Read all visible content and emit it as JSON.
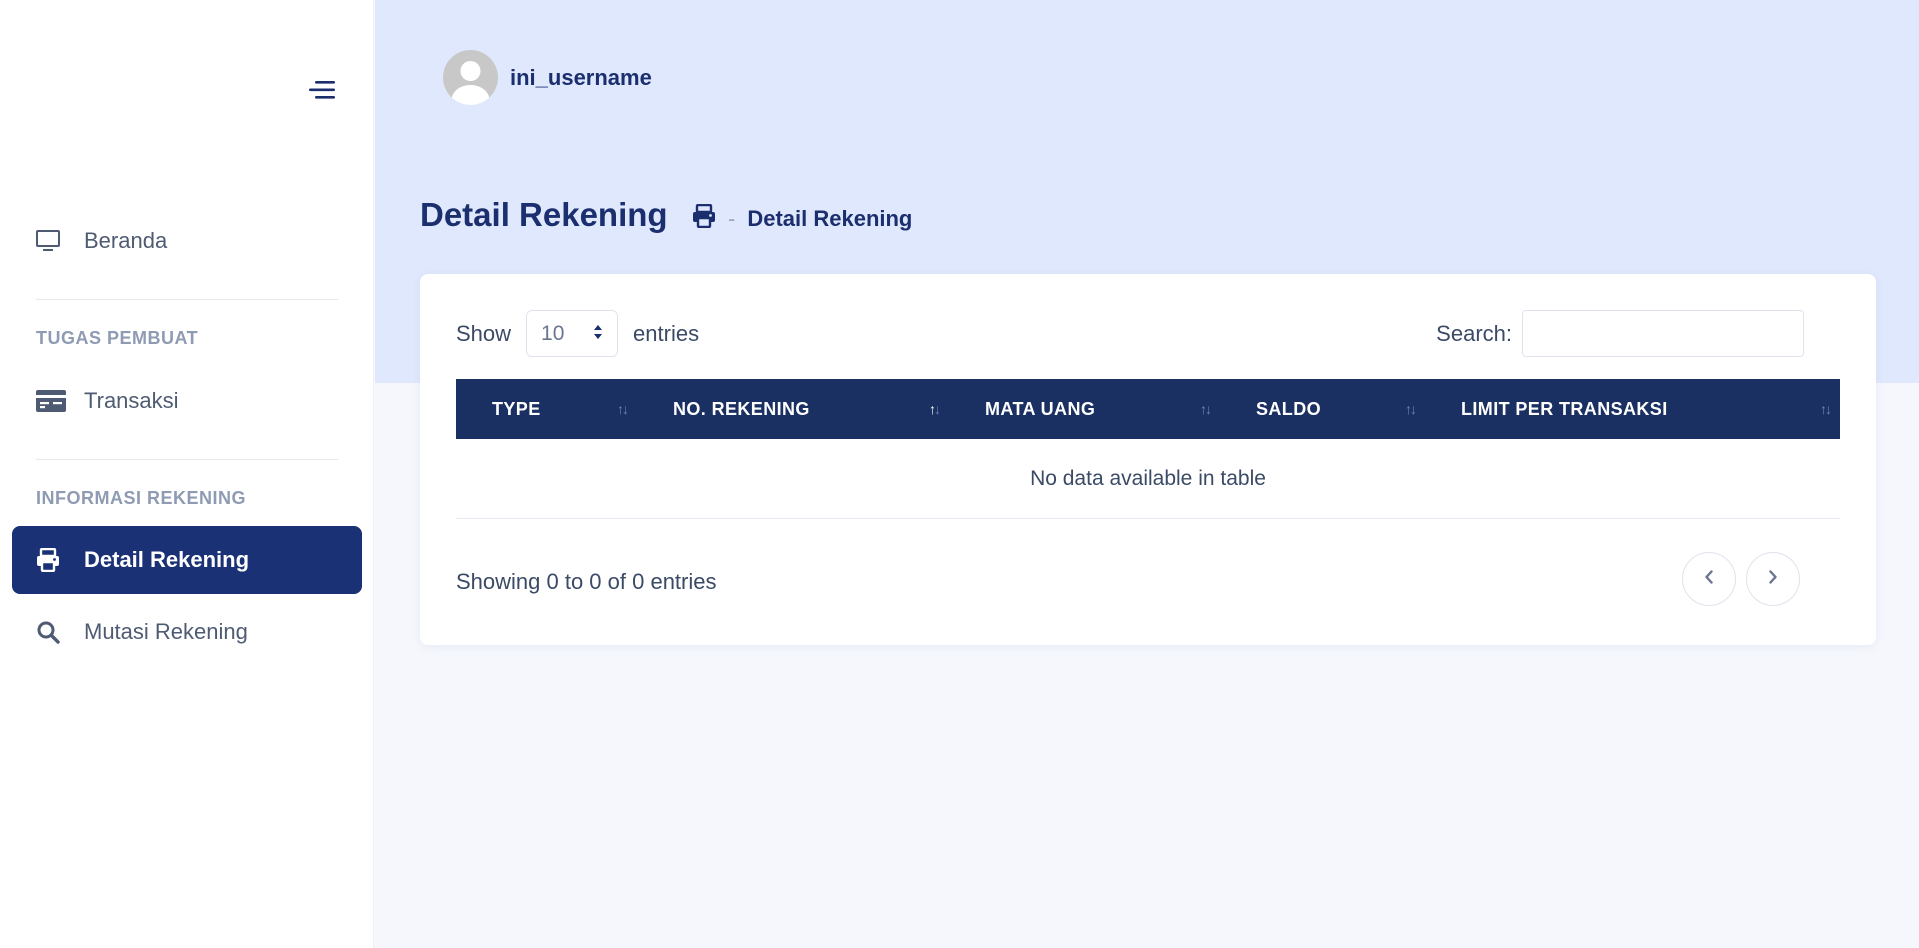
{
  "sidebar": {
    "items": [
      {
        "label": "Beranda",
        "icon": "monitor-icon"
      },
      {
        "label": "Transaksi",
        "icon": "credit-card-icon"
      },
      {
        "label": "Detail Rekening",
        "icon": "printer-icon",
        "active": true
      },
      {
        "label": "Mutasi Rekening",
        "icon": "search-icon"
      }
    ],
    "sections": {
      "tugas": "TUGAS PEMBUAT",
      "informasi": "INFORMASI REKENING"
    }
  },
  "header": {
    "username": "ini_username"
  },
  "page": {
    "title": "Detail Rekening",
    "breadcrumb_sep": "-",
    "breadcrumb_current": "Detail Rekening"
  },
  "table": {
    "length_label_before": "Show",
    "length_value": "10",
    "length_label_after": "entries",
    "search_label": "Search:",
    "search_value": "",
    "columns": [
      "TYPE",
      "NO. REKENING",
      "MATA UANG",
      "SALDO",
      "LIMIT PER TRANSAKSI"
    ],
    "sorted_column": "NO. REKENING",
    "empty_message": "No data available in table",
    "info": "Showing 0 to 0 of 0 entries"
  },
  "colors": {
    "accent": "#1b3175",
    "table_header": "#1b3062",
    "hero_bg": "#e0e8fd"
  }
}
